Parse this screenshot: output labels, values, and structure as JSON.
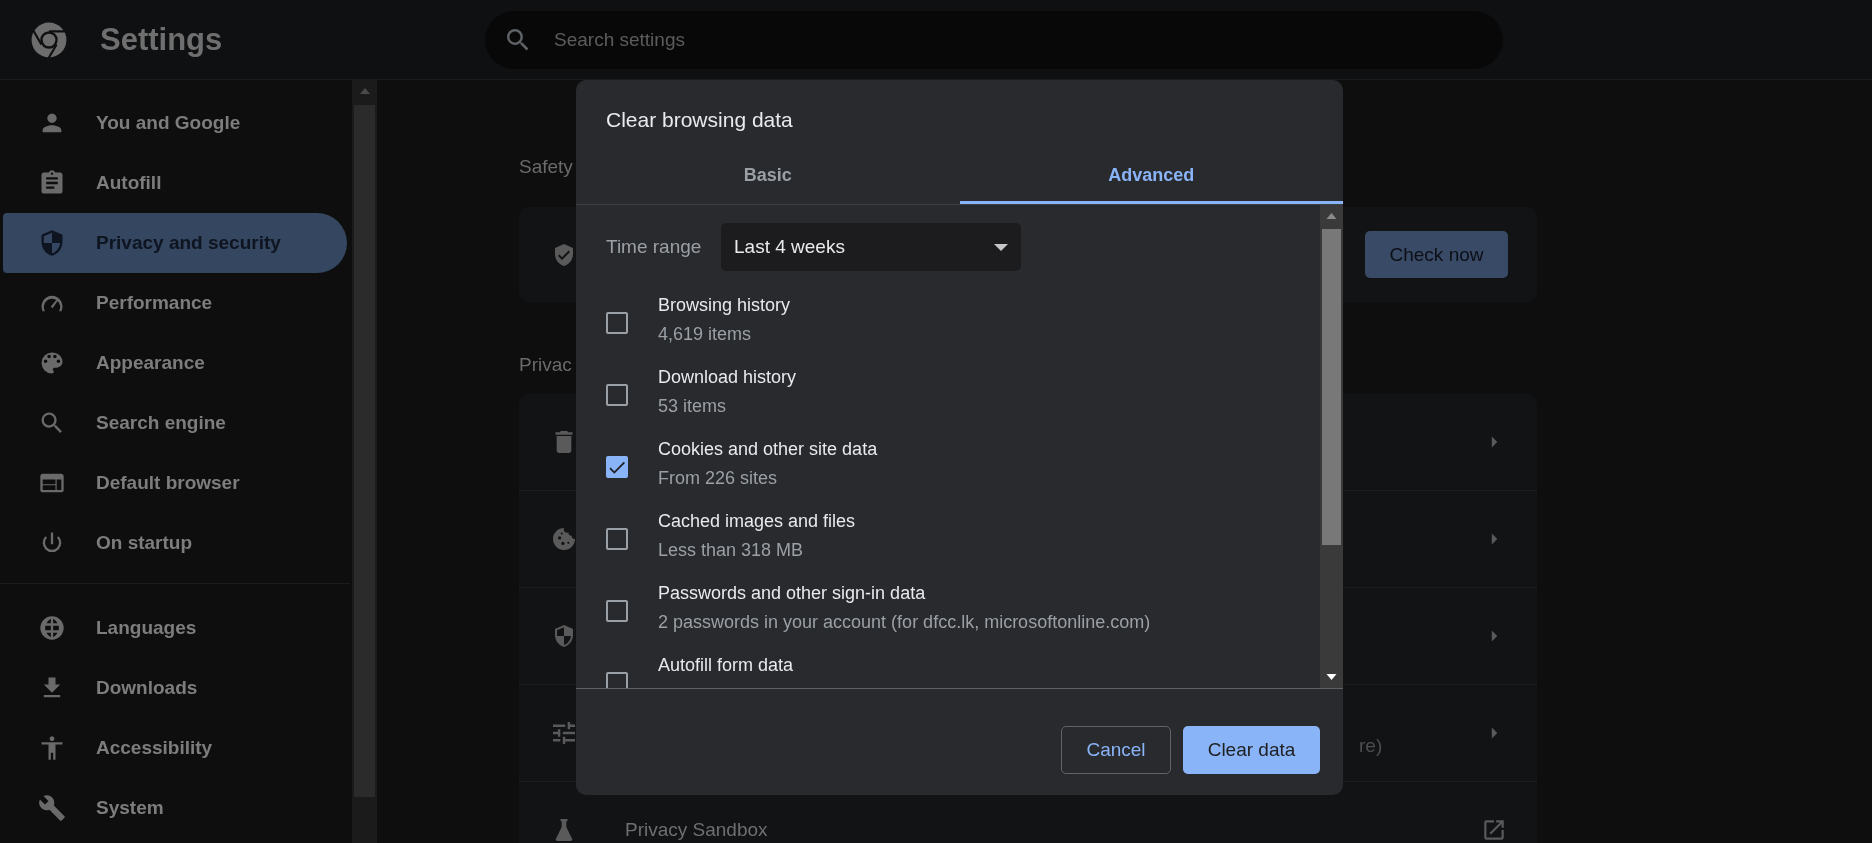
{
  "header": {
    "title": "Settings",
    "search": {
      "placeholder": "Search settings"
    }
  },
  "sidebar": {
    "groups": [
      {
        "items": [
          {
            "label": "You and Google",
            "selected": false
          },
          {
            "label": "Autofill",
            "selected": false
          },
          {
            "label": "Privacy and security",
            "selected": true
          },
          {
            "label": "Performance",
            "selected": false
          },
          {
            "label": "Appearance",
            "selected": false
          },
          {
            "label": "Search engine",
            "selected": false
          },
          {
            "label": "Default browser",
            "selected": false
          },
          {
            "label": "On startup",
            "selected": false
          }
        ]
      },
      {
        "items": [
          {
            "label": "Languages",
            "selected": false
          },
          {
            "label": "Downloads",
            "selected": false
          },
          {
            "label": "Accessibility",
            "selected": false
          },
          {
            "label": "System",
            "selected": false
          }
        ]
      }
    ]
  },
  "safety_check": {
    "heading": "Safety",
    "button": "Check now"
  },
  "privacy": {
    "heading": "Privac",
    "rows": [
      {
        "kind": "arrow"
      },
      {
        "kind": "arrow"
      },
      {
        "kind": "arrow"
      },
      {
        "kind": "arrow",
        "subtitle": "re)"
      },
      {
        "kind": "external",
        "title": "Privacy Sandbox"
      }
    ]
  },
  "dialog": {
    "title": "Clear browsing data",
    "tabs": [
      {
        "label": "Basic",
        "selected": false
      },
      {
        "label": "Advanced",
        "selected": true
      }
    ],
    "time_range": {
      "label": "Time range",
      "value": "Last 4 weeks"
    },
    "options": [
      {
        "title": "Browsing history",
        "detail": "4,619 items",
        "checked": false
      },
      {
        "title": "Download history",
        "detail": "53 items",
        "checked": false
      },
      {
        "title": "Cookies and other site data",
        "detail": "From 226 sites",
        "checked": true
      },
      {
        "title": "Cached images and files",
        "detail": "Less than 318 MB",
        "checked": false
      },
      {
        "title": "Passwords and other sign-in data",
        "detail": "2 passwords in your account (for dfcc.lk, microsoftonline.com)",
        "checked": false
      },
      {
        "title": "Autofill form data",
        "checked": false
      }
    ],
    "buttons": [
      {
        "label": "Cancel",
        "kind": "secondary"
      },
      {
        "label": "Clear data",
        "kind": "primary"
      }
    ]
  }
}
